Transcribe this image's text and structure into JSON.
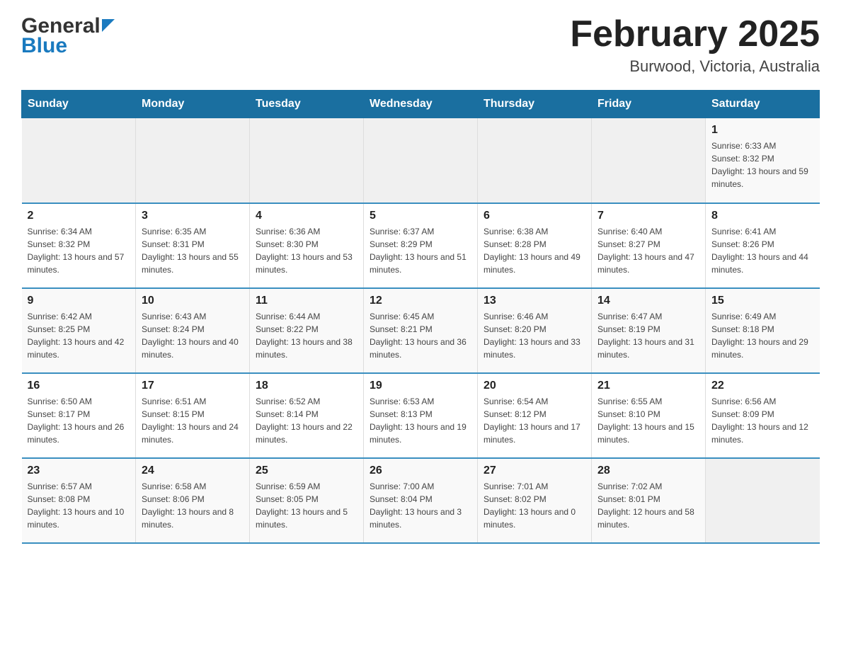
{
  "header": {
    "logo_general": "General",
    "logo_blue": "Blue",
    "month_title": "February 2025",
    "location": "Burwood, Victoria, Australia"
  },
  "days_of_week": [
    "Sunday",
    "Monday",
    "Tuesday",
    "Wednesday",
    "Thursday",
    "Friday",
    "Saturday"
  ],
  "weeks": [
    [
      {
        "day": "",
        "info": ""
      },
      {
        "day": "",
        "info": ""
      },
      {
        "day": "",
        "info": ""
      },
      {
        "day": "",
        "info": ""
      },
      {
        "day": "",
        "info": ""
      },
      {
        "day": "",
        "info": ""
      },
      {
        "day": "1",
        "info": "Sunrise: 6:33 AM\nSunset: 8:32 PM\nDaylight: 13 hours and 59 minutes."
      }
    ],
    [
      {
        "day": "2",
        "info": "Sunrise: 6:34 AM\nSunset: 8:32 PM\nDaylight: 13 hours and 57 minutes."
      },
      {
        "day": "3",
        "info": "Sunrise: 6:35 AM\nSunset: 8:31 PM\nDaylight: 13 hours and 55 minutes."
      },
      {
        "day": "4",
        "info": "Sunrise: 6:36 AM\nSunset: 8:30 PM\nDaylight: 13 hours and 53 minutes."
      },
      {
        "day": "5",
        "info": "Sunrise: 6:37 AM\nSunset: 8:29 PM\nDaylight: 13 hours and 51 minutes."
      },
      {
        "day": "6",
        "info": "Sunrise: 6:38 AM\nSunset: 8:28 PM\nDaylight: 13 hours and 49 minutes."
      },
      {
        "day": "7",
        "info": "Sunrise: 6:40 AM\nSunset: 8:27 PM\nDaylight: 13 hours and 47 minutes."
      },
      {
        "day": "8",
        "info": "Sunrise: 6:41 AM\nSunset: 8:26 PM\nDaylight: 13 hours and 44 minutes."
      }
    ],
    [
      {
        "day": "9",
        "info": "Sunrise: 6:42 AM\nSunset: 8:25 PM\nDaylight: 13 hours and 42 minutes."
      },
      {
        "day": "10",
        "info": "Sunrise: 6:43 AM\nSunset: 8:24 PM\nDaylight: 13 hours and 40 minutes."
      },
      {
        "day": "11",
        "info": "Sunrise: 6:44 AM\nSunset: 8:22 PM\nDaylight: 13 hours and 38 minutes."
      },
      {
        "day": "12",
        "info": "Sunrise: 6:45 AM\nSunset: 8:21 PM\nDaylight: 13 hours and 36 minutes."
      },
      {
        "day": "13",
        "info": "Sunrise: 6:46 AM\nSunset: 8:20 PM\nDaylight: 13 hours and 33 minutes."
      },
      {
        "day": "14",
        "info": "Sunrise: 6:47 AM\nSunset: 8:19 PM\nDaylight: 13 hours and 31 minutes."
      },
      {
        "day": "15",
        "info": "Sunrise: 6:49 AM\nSunset: 8:18 PM\nDaylight: 13 hours and 29 minutes."
      }
    ],
    [
      {
        "day": "16",
        "info": "Sunrise: 6:50 AM\nSunset: 8:17 PM\nDaylight: 13 hours and 26 minutes."
      },
      {
        "day": "17",
        "info": "Sunrise: 6:51 AM\nSunset: 8:15 PM\nDaylight: 13 hours and 24 minutes."
      },
      {
        "day": "18",
        "info": "Sunrise: 6:52 AM\nSunset: 8:14 PM\nDaylight: 13 hours and 22 minutes."
      },
      {
        "day": "19",
        "info": "Sunrise: 6:53 AM\nSunset: 8:13 PM\nDaylight: 13 hours and 19 minutes."
      },
      {
        "day": "20",
        "info": "Sunrise: 6:54 AM\nSunset: 8:12 PM\nDaylight: 13 hours and 17 minutes."
      },
      {
        "day": "21",
        "info": "Sunrise: 6:55 AM\nSunset: 8:10 PM\nDaylight: 13 hours and 15 minutes."
      },
      {
        "day": "22",
        "info": "Sunrise: 6:56 AM\nSunset: 8:09 PM\nDaylight: 13 hours and 12 minutes."
      }
    ],
    [
      {
        "day": "23",
        "info": "Sunrise: 6:57 AM\nSunset: 8:08 PM\nDaylight: 13 hours and 10 minutes."
      },
      {
        "day": "24",
        "info": "Sunrise: 6:58 AM\nSunset: 8:06 PM\nDaylight: 13 hours and 8 minutes."
      },
      {
        "day": "25",
        "info": "Sunrise: 6:59 AM\nSunset: 8:05 PM\nDaylight: 13 hours and 5 minutes."
      },
      {
        "day": "26",
        "info": "Sunrise: 7:00 AM\nSunset: 8:04 PM\nDaylight: 13 hours and 3 minutes."
      },
      {
        "day": "27",
        "info": "Sunrise: 7:01 AM\nSunset: 8:02 PM\nDaylight: 13 hours and 0 minutes."
      },
      {
        "day": "28",
        "info": "Sunrise: 7:02 AM\nSunset: 8:01 PM\nDaylight: 12 hours and 58 minutes."
      },
      {
        "day": "",
        "info": ""
      }
    ]
  ]
}
